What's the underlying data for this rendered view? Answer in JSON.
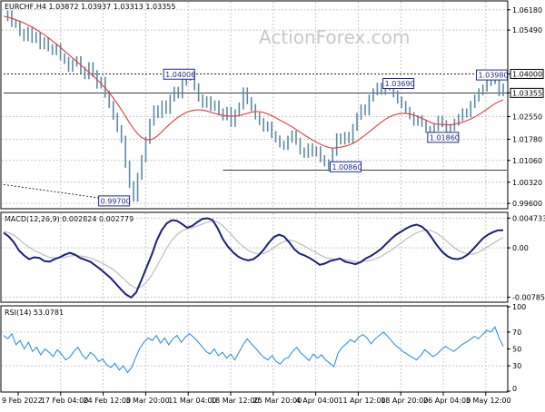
{
  "watermark": "ActionForex.com",
  "chart_data": [
    {
      "type": "line",
      "name": "price-panel",
      "header": "EURCHF,H4 1.03872 1.03937 1.03313 1.03355",
      "ylim": [
        0.9945,
        1.0645
      ],
      "y_ticks": [
        "1.06180",
        "1.05490",
        "1.04000",
        "1.03355",
        "1.02550",
        "1.01780",
        "1.01060",
        "1.00320",
        "0.99600"
      ],
      "y_tick_values": [
        1.0618,
        1.0549,
        1.04,
        1.03355,
        1.0255,
        1.0178,
        1.0106,
        1.0032,
        0.996
      ],
      "price_label": "1.03355",
      "level_label": "1.04000",
      "annotations": [
        {
          "label": "1.04006",
          "x": 47,
          "y": 1.04006
        },
        {
          "label": "1.03690",
          "x": 101,
          "y": 1.0369
        },
        {
          "label": "1.03980",
          "x": 124,
          "y": 1.0398
        },
        {
          "label": "1.01860",
          "x": 112,
          "y": 1.0186
        },
        {
          "label": "1.00860",
          "x": 88,
          "y": 1.0086
        },
        {
          "label": "0.99700",
          "x": 31,
          "y": 0.997
        }
      ],
      "horizontal_lines": [
        {
          "y": 1.04,
          "style": "dotted",
          "x_from": 0,
          "x_to": 128
        },
        {
          "y": 1.03355,
          "style": "solid",
          "x_from": 0,
          "x_to": 128
        },
        {
          "y": 1.0073,
          "style": "solid",
          "x_from": 54,
          "x_to": 128
        }
      ],
      "trendline": {
        "x1": 0,
        "y1": 1.0024,
        "x2": 28,
        "y2": 0.997
      },
      "series": [
        {
          "name": "price",
          "values": [
            1.0591,
            1.0604,
            1.0572,
            1.0568,
            1.0541,
            1.0523,
            1.0548,
            1.0517,
            1.0531,
            1.0496,
            1.0513,
            1.0489,
            1.0476,
            1.0492,
            1.0458,
            1.0446,
            1.0419,
            1.0437,
            1.0448,
            1.0412,
            1.0394,
            1.0428,
            1.0401,
            1.0362,
            1.0378,
            1.0331,
            1.0296,
            1.0256,
            1.0214,
            1.0178,
            1.0093,
            1.0024,
            0.9978,
            1.0052,
            1.0112,
            1.0174,
            1.0236,
            1.0281,
            1.0262,
            1.0298,
            1.0276,
            1.0318,
            1.0344,
            1.0329,
            1.0372,
            1.0389,
            1.0394,
            1.0356,
            1.0318,
            1.0297,
            1.0312,
            1.0286,
            1.0298,
            1.0271,
            1.0254,
            1.0276,
            1.0232,
            1.0268,
            1.0291,
            1.0342,
            1.0309,
            1.0286,
            1.0257,
            1.0238,
            1.0216,
            1.0226,
            1.0194,
            1.0179,
            1.0162,
            1.0154,
            1.0178,
            1.0196,
            1.0171,
            1.0138,
            1.0127,
            1.0152,
            1.0131,
            1.0142,
            1.0112,
            1.0098,
            1.0081,
            1.0134,
            1.0186,
            1.0172,
            1.0191,
            1.0176,
            1.0218,
            1.0256,
            1.0284,
            1.0271,
            1.0318,
            1.0339,
            1.0358,
            1.0341,
            1.0369,
            1.0356,
            1.0332,
            1.0311,
            1.0296,
            1.0276,
            1.0258,
            1.0236,
            1.0248,
            1.0232,
            1.0211,
            1.0196,
            1.0218,
            1.0246,
            1.0231,
            1.0208,
            1.0218,
            1.0236,
            1.0252,
            1.0271,
            1.0264,
            1.0296,
            1.0318,
            1.0339,
            1.0352,
            1.0371,
            1.0394,
            1.0378,
            1.0336,
            1.0355
          ]
        },
        {
          "name": "moving-average",
          "values": [
            1.0596,
            1.0593,
            1.0589,
            1.0584,
            1.0579,
            1.0573,
            1.0566,
            1.0559,
            1.0551,
            1.0542,
            1.0533,
            1.0523,
            1.0512,
            1.0501,
            1.049,
            1.0478,
            1.0466,
            1.0454,
            1.0442,
            1.043,
            1.0418,
            1.0406,
            1.0394,
            1.0381,
            1.0367,
            1.0352,
            1.0336,
            1.0318,
            1.0299,
            1.0278,
            1.0256,
            1.0234,
            1.0214,
            1.0196,
            1.0184,
            1.0177,
            1.0176,
            1.0181,
            1.0191,
            1.0204,
            1.0218,
            1.0231,
            1.0243,
            1.0253,
            1.0262,
            1.0269,
            1.0274,
            1.0277,
            1.0278,
            1.0277,
            1.0274,
            1.027,
            1.0266,
            1.0262,
            1.0259,
            1.0257,
            1.0256,
            1.0257,
            1.0258,
            1.0262,
            1.0266,
            1.027,
            1.0272,
            1.0272,
            1.0269,
            1.0264,
            1.0258,
            1.0251,
            1.0243,
            1.0236,
            1.0228,
            1.022,
            1.0211,
            1.0202,
            1.0193,
            1.0184,
            1.0176,
            1.0168,
            1.0161,
            1.0155,
            1.015,
            1.0148,
            1.0149,
            1.0151,
            1.0154,
            1.0158,
            1.0164,
            1.0172,
            1.0182,
            1.0192,
            1.0203,
            1.0214,
            1.0226,
            1.0236,
            1.0246,
            1.0254,
            1.026,
            1.0264,
            1.0266,
            1.0266,
            1.0264,
            1.026,
            1.0255,
            1.0249,
            1.0243,
            1.0236,
            1.0231,
            1.0229,
            1.0228,
            1.0227,
            1.0227,
            1.0229,
            1.0232,
            1.0236,
            1.0241,
            1.0247,
            1.0254,
            1.0262,
            1.0271,
            1.028,
            1.029,
            1.0299,
            1.0306,
            1.0312
          ]
        }
      ]
    },
    {
      "type": "line",
      "name": "macd-panel",
      "header": "MACD(12,26,9) 0.002824 0.002779",
      "ylim": [
        -0.0085,
        0.0055
      ],
      "y_ticks": [
        "0.004733",
        "0.00",
        "-0.00785"
      ],
      "y_tick_values": [
        0.004733,
        0.0,
        -0.00785
      ],
      "series": [
        {
          "name": "macd",
          "values": [
            0.0024,
            0.0018,
            0.0009,
            -0.0004,
            -0.0012,
            -0.0018,
            -0.0015,
            -0.0016,
            -0.0021,
            -0.0022,
            -0.0018,
            -0.0015,
            -0.0011,
            -0.0008,
            -0.0011,
            -0.0016,
            -0.0019,
            -0.0022,
            -0.0028,
            -0.0034,
            -0.0041,
            -0.0048,
            -0.0057,
            -0.0066,
            -0.0074,
            -0.0079,
            -0.0071,
            -0.0052,
            -0.0032,
            -0.0012,
            0.0011,
            0.0028,
            0.0039,
            0.0044,
            0.0043,
            0.0038,
            0.0032,
            0.0035,
            0.0041,
            0.0046,
            0.0047,
            0.0044,
            0.0031,
            0.0014,
            0.0002,
            -0.0007,
            -0.0014,
            -0.0018,
            -0.002,
            -0.0018,
            -0.0012,
            -0.0003,
            0.0008,
            0.0017,
            0.0021,
            0.0018,
            0.0009,
            -0.0002,
            -0.0009,
            -0.0012,
            -0.0016,
            -0.0021,
            -0.0027,
            -0.0025,
            -0.0021,
            -0.0019,
            -0.0017,
            -0.0022,
            -0.0024,
            -0.0026,
            -0.0023,
            -0.0017,
            -0.0013,
            -0.0008,
            -0.0002,
            0.0006,
            0.0014,
            0.0021,
            0.0026,
            0.0031,
            0.0035,
            0.0037,
            0.0034,
            0.0027,
            0.0016,
            0.0004,
            -0.0006,
            -0.0013,
            -0.0017,
            -0.0018,
            -0.0016,
            -0.0011,
            -0.0003,
            0.0006,
            0.0015,
            0.0021,
            0.0025,
            0.0028,
            0.0028
          ]
        },
        {
          "name": "signal",
          "values": [
            0.0026,
            0.0024,
            0.002,
            0.0014,
            0.0007,
            0.0001,
            -0.0004,
            -0.0008,
            -0.0012,
            -0.0015,
            -0.0016,
            -0.0016,
            -0.0015,
            -0.0013,
            -0.0012,
            -0.0013,
            -0.0014,
            -0.0016,
            -0.0019,
            -0.0023,
            -0.0027,
            -0.0032,
            -0.0038,
            -0.0045,
            -0.0053,
            -0.006,
            -0.0064,
            -0.0062,
            -0.0055,
            -0.0044,
            -0.003,
            -0.0015,
            0.0,
            0.0012,
            0.0021,
            0.0027,
            0.003,
            0.0032,
            0.0035,
            0.0038,
            0.0041,
            0.0042,
            0.0041,
            0.0035,
            0.0027,
            0.0018,
            0.0009,
            0.0002,
            -0.0004,
            -0.0008,
            -0.001,
            -0.0009,
            -0.0005,
            0.0,
            0.0006,
            0.001,
            0.0012,
            0.0011,
            0.0007,
            0.0003,
            -0.0002,
            -0.0006,
            -0.0011,
            -0.0015,
            -0.0017,
            -0.0018,
            -0.0018,
            -0.0019,
            -0.002,
            -0.0022,
            -0.0022,
            -0.0021,
            -0.002,
            -0.0017,
            -0.0014,
            -0.0009,
            -0.0004,
            0.0002,
            0.0008,
            0.0014,
            0.0019,
            0.0024,
            0.0027,
            0.0028,
            0.0027,
            0.0023,
            0.0017,
            0.001,
            0.0003,
            -0.0003,
            -0.0007,
            -0.001,
            -0.001,
            -0.0008,
            -0.0003,
            0.0002,
            0.0007,
            0.0012,
            0.0016
          ]
        }
      ]
    },
    {
      "type": "line",
      "name": "rsi-panel",
      "header": "RSI(14) 53.0781",
      "ylim": [
        0,
        100
      ],
      "y_ticks": [
        "100",
        "70",
        "50",
        "30",
        "0"
      ],
      "y_tick_values": [
        100,
        70,
        50,
        30,
        0
      ],
      "levels": [
        70,
        30
      ],
      "series": [
        {
          "name": "rsi",
          "values": [
            66,
            62,
            68,
            55,
            60,
            50,
            58,
            47,
            52,
            43,
            50,
            46,
            41,
            49,
            44,
            37,
            40,
            47,
            52,
            43,
            38,
            46,
            42,
            35,
            38,
            31,
            28,
            33,
            25,
            30,
            22,
            28,
            40,
            51,
            58,
            63,
            60,
            66,
            57,
            63,
            55,
            62,
            66,
            58,
            64,
            68,
            64,
            59,
            53,
            47,
            44,
            50,
            42,
            46,
            39,
            44,
            37,
            46,
            55,
            62,
            56,
            51,
            45,
            40,
            37,
            42,
            35,
            32,
            38,
            40,
            47,
            52,
            45,
            41,
            36,
            44,
            39,
            43,
            37,
            33,
            29,
            45,
            52,
            56,
            61,
            58,
            64,
            67,
            63,
            56,
            62,
            66,
            70,
            65,
            59,
            54,
            50,
            46,
            43,
            40,
            37,
            42,
            49,
            45,
            41,
            44,
            49,
            53,
            50,
            47,
            51,
            55,
            58,
            61,
            65,
            62,
            67,
            72,
            70,
            76,
            63,
            53
          ]
        }
      ]
    }
  ],
  "x_axis": {
    "tick_labels": [
      "9 Feb 2022",
      "17 Feb 04:00",
      "24 Feb 12:00",
      "3 Mar 20:00",
      "11 Mar 04:00",
      "18 Mar 12:00",
      "25 Mar 20:00",
      "4 Apr 04:00",
      "11 Apr 12:00",
      "18 Apr 20:00",
      "26 Apr 04:00",
      "3 May 12:00"
    ]
  },
  "colors": {
    "price": "#5c8aa3",
    "moving_average": "#e03a3a",
    "macd": "#1b1f7e",
    "signal": "#bdbdbd",
    "rsi": "#1e88e5",
    "annotation": "#1f2a8a"
  }
}
